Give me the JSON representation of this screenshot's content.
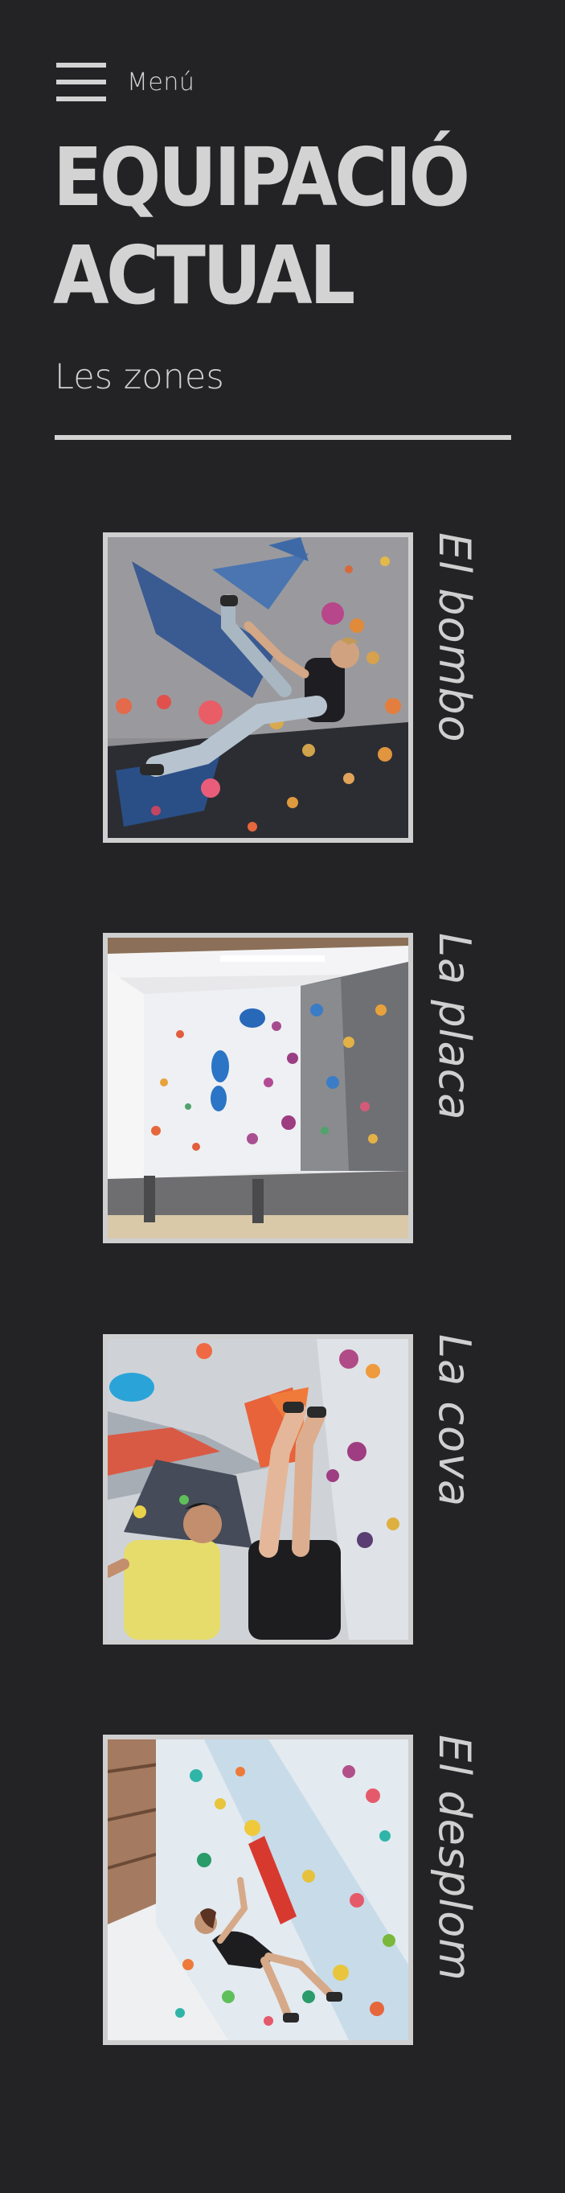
{
  "menu": {
    "label": "Menú"
  },
  "header": {
    "title_line1": "EQUIPACIÓ",
    "title_line2": "ACTUAL",
    "subtitle": "Les zones"
  },
  "zones": [
    {
      "label": "El bombo",
      "image": "climber-on-blue-volume"
    },
    {
      "label": "La placa",
      "image": "empty-climbing-room"
    },
    {
      "label": "La cova",
      "image": "two-climbers-in-cave"
    },
    {
      "label": "El desplom",
      "image": "climber-on-overhang"
    }
  ],
  "colors": {
    "background": "#232325",
    "text": "#d3d3d3"
  }
}
